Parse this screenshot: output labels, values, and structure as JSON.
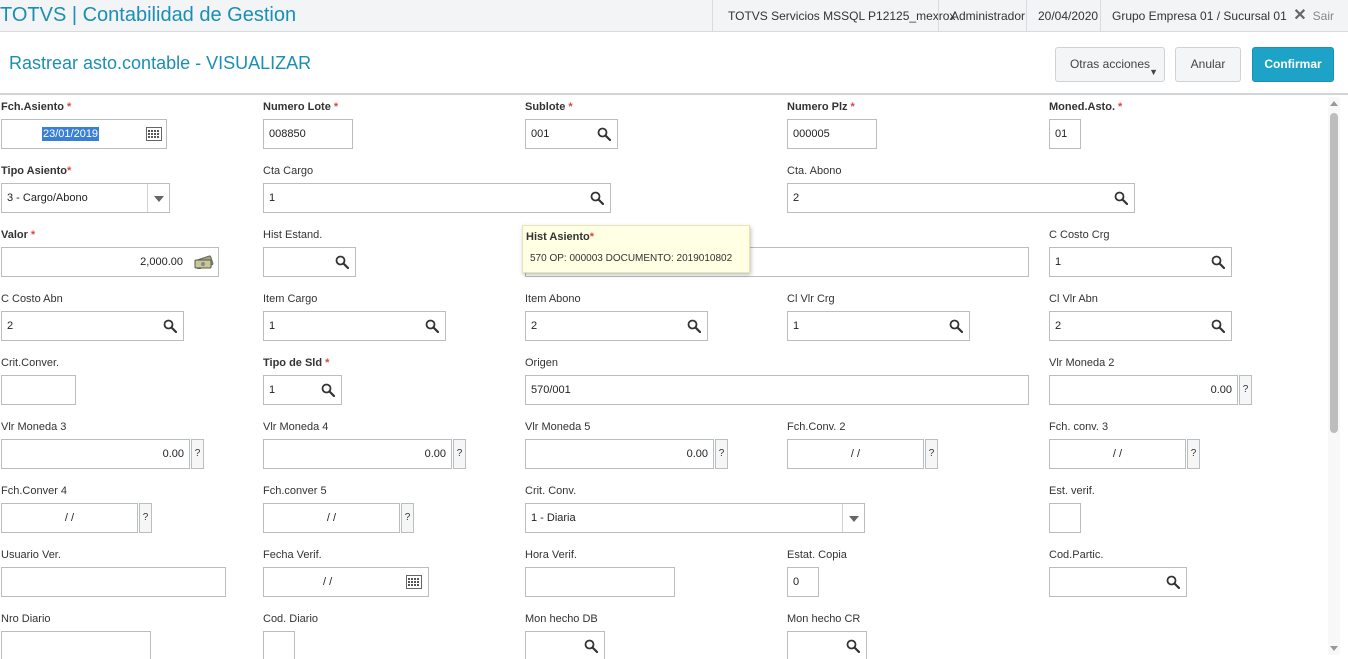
{
  "topbar": {
    "app_title": "TOTVS | Contabilidad de Gestion",
    "environment": "TOTVS Servicios MSSQL P12125_mexrox",
    "user": "Administrador",
    "date": "20/04/2020",
    "company": "Grupo Empresa 01 / Sucursal 01",
    "exit_label": "Sair"
  },
  "header": {
    "title": "Rastrear asto.contable - VISUALIZAR",
    "other_actions_label": "Otras acciones",
    "cancel_label": "Anular",
    "confirm_label": "Confirmar"
  },
  "tooltip": {
    "title": "Hist Asiento",
    "text": "570 OP: 000003 DOCUMENTO: 2019010802"
  },
  "fields": {
    "fch_asiento": {
      "label": "Fch.Asiento",
      "value": "23/01/2019"
    },
    "numero_lote": {
      "label": "Numero Lote",
      "value": "008850"
    },
    "sublote": {
      "label": "Sublote",
      "value": "001"
    },
    "numero_plz": {
      "label": "Numero Plz",
      "value": "000005"
    },
    "moned_asto": {
      "label": "Moned.Asto.",
      "value": "01"
    },
    "tipo_asiento": {
      "label": "Tipo Asiento",
      "value": "3 - Cargo/Abono"
    },
    "cta_cargo": {
      "label": "Cta Cargo",
      "value": "1"
    },
    "cta_abono": {
      "label": "Cta. Abono",
      "value": "2"
    },
    "valor": {
      "label": "Valor",
      "value": "2,000.00"
    },
    "hist_estand": {
      "label": "Hist Estand.",
      "value": ""
    },
    "c_costo_crg": {
      "label": "C Costo Crg",
      "value": "1"
    },
    "c_costo_abn": {
      "label": "C Costo Abn",
      "value": "2"
    },
    "item_cargo": {
      "label": "Item Cargo",
      "value": "1"
    },
    "item_abono": {
      "label": "Item Abono",
      "value": "2"
    },
    "cl_vlr_crg": {
      "label": "Cl Vlr Crg",
      "value": "1"
    },
    "cl_vlr_abn": {
      "label": "Cl Vlr Abn",
      "value": "2"
    },
    "crit_conver": {
      "label": "Crit.Conver.",
      "value": ""
    },
    "tipo_de_sld": {
      "label": "Tipo de Sld",
      "value": "1"
    },
    "origen": {
      "label": "Origen",
      "value": "570/001"
    },
    "vlr_moneda_2": {
      "label": "Vlr Moneda 2",
      "value": "0.00"
    },
    "vlr_moneda_3": {
      "label": "Vlr Moneda 3",
      "value": "0.00"
    },
    "vlr_moneda_4": {
      "label": "Vlr Moneda 4",
      "value": "0.00"
    },
    "vlr_moneda_5": {
      "label": "Vlr Moneda 5",
      "value": "0.00"
    },
    "fch_conv_2": {
      "label": "Fch.Conv. 2",
      "value": "/ /"
    },
    "fch_conv_3": {
      "label": "Fch. conv. 3",
      "value": "/ /"
    },
    "fch_conver_4": {
      "label": "Fch.Conver 4",
      "value": "/ /"
    },
    "fch_conver_5": {
      "label": "Fch.conver 5",
      "value": "/ /"
    },
    "crit_conv": {
      "label": "Crit. Conv.",
      "value": "1 - Diaria"
    },
    "est_verif": {
      "label": "Est. verif.",
      "value": ""
    },
    "usuario_ver": {
      "label": "Usuario Ver.",
      "value": ""
    },
    "fecha_verif": {
      "label": "Fecha Verif.",
      "value": "/ /"
    },
    "hora_verif": {
      "label": "Hora Verif.",
      "value": ""
    },
    "estat_copia": {
      "label": "Estat. Copia",
      "value": "0"
    },
    "cod_partic": {
      "label": "Cod.Partic.",
      "value": ""
    },
    "nro_diario": {
      "label": "Nro Diario",
      "value": ""
    },
    "cod_diario": {
      "label": "Cod. Diario",
      "value": ""
    },
    "mon_hecho_db": {
      "label": "Mon hecho DB",
      "value": ""
    },
    "mon_hecho_cr": {
      "label": "Mon hecho CR",
      "value": ""
    }
  },
  "help_button_label": "?",
  "colors": {
    "brand": "#1a8fb5",
    "primary_button": "#1ea3c8",
    "required_star": "#e0443c",
    "tooltip_bg": "#ffffe3"
  },
  "icons": [
    "search-icon",
    "calendar-icon",
    "money-icon",
    "dropdown-arrow-icon",
    "close-icon"
  ]
}
